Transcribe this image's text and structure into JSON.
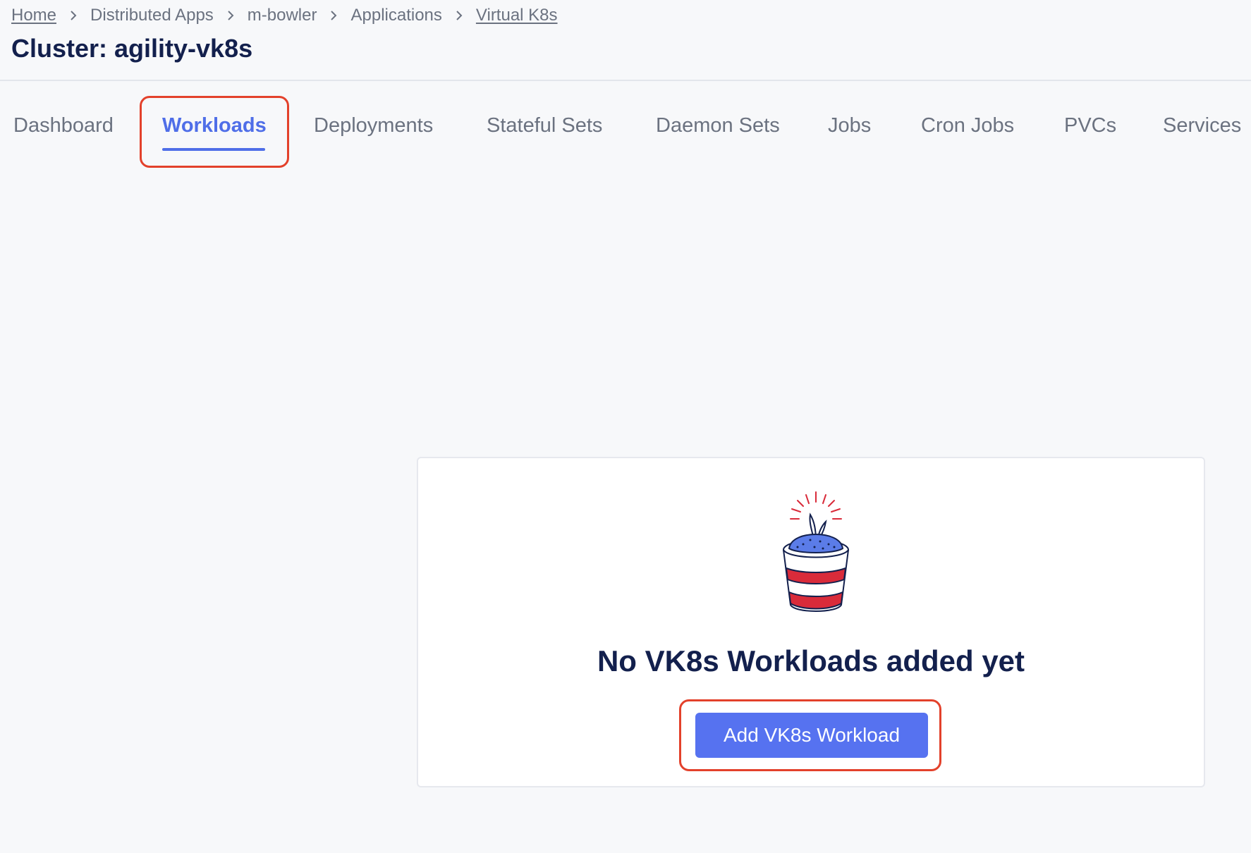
{
  "breadcrumb": {
    "items": [
      {
        "label": "Home"
      },
      {
        "label": "Distributed Apps"
      },
      {
        "label": "m-bowler"
      },
      {
        "label": "Applications"
      },
      {
        "label": "Virtual K8s"
      }
    ]
  },
  "page": {
    "title": "Cluster: agility-vk8s"
  },
  "tabs": [
    {
      "label": "Dashboard",
      "active": false
    },
    {
      "label": "Workloads",
      "active": true
    },
    {
      "label": "Deployments",
      "active": false
    },
    {
      "label": "Stateful Sets",
      "active": false
    },
    {
      "label": "Daemon Sets",
      "active": false
    },
    {
      "label": "Jobs",
      "active": false
    },
    {
      "label": "Cron Jobs",
      "active": false
    },
    {
      "label": "PVCs",
      "active": false
    },
    {
      "label": "Services",
      "active": false
    }
  ],
  "empty_state": {
    "illustration": "plant-pot-icon",
    "title": "No VK8s Workloads added yet",
    "button_label": "Add VK8s Workload"
  },
  "colors": {
    "accent": "#4f6ee8",
    "button": "#5672f0",
    "highlight": "#e3412b",
    "pot_red": "#d92b3a",
    "soil_blue": "#5b7ce8"
  }
}
